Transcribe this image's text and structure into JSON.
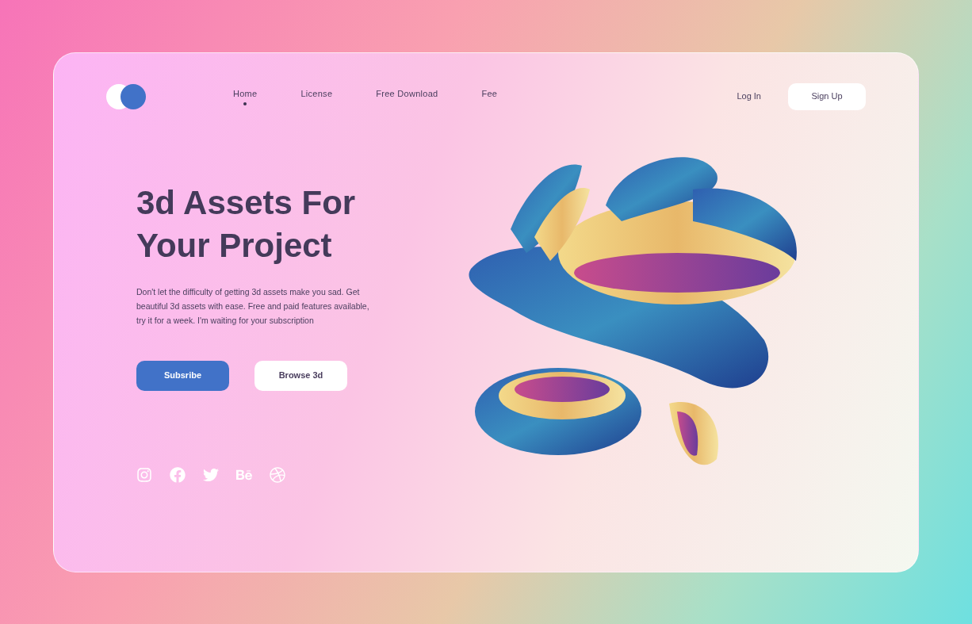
{
  "nav": {
    "items": [
      {
        "label": "Home",
        "selected": true
      },
      {
        "label": "License",
        "selected": false
      },
      {
        "label": "Free Download",
        "selected": false
      },
      {
        "label": "Fee",
        "selected": false
      }
    ],
    "login": "Log In",
    "signup": "Sign Up"
  },
  "hero": {
    "title_lines": [
      "3d Assets For",
      "Your Project"
    ],
    "description": "Don't let the difficulty of getting 3d assets make you sad. Get beautiful 3d assets with ease. Free and paid features available, try it for a week. I'm waiting for your subscription",
    "primary_button": "Subsribe",
    "secondary_button": "Browse 3d"
  },
  "social": [
    {
      "kind": "instagram"
    },
    {
      "kind": "facebook"
    },
    {
      "kind": "twitter"
    },
    {
      "kind": "behance"
    },
    {
      "kind": "dribbble"
    }
  ]
}
